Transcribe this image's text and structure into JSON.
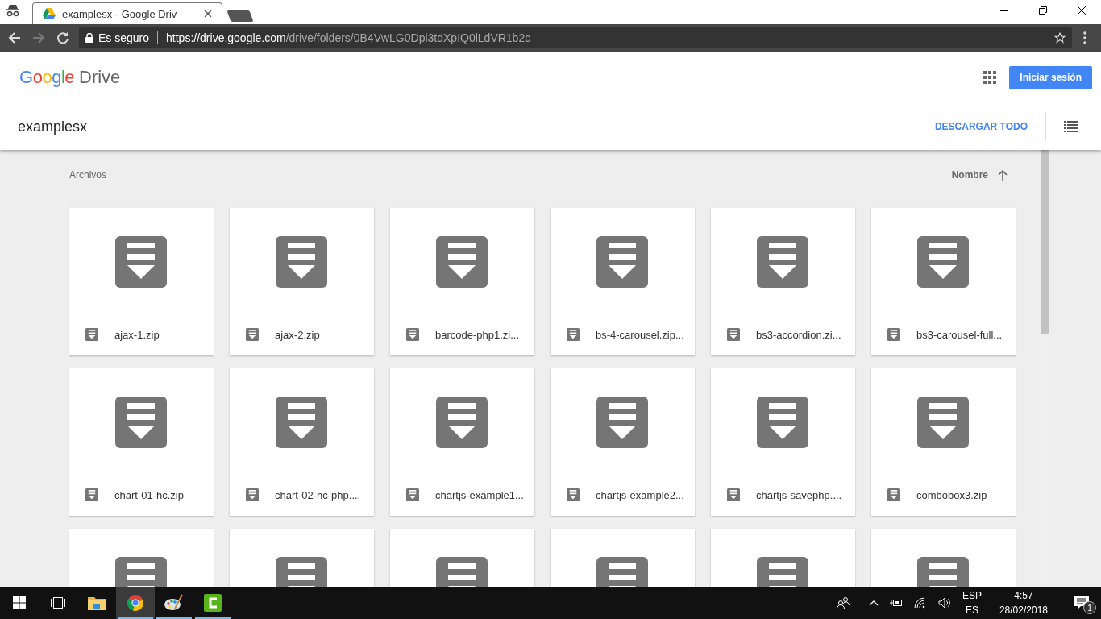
{
  "browser": {
    "tabs": [
      {
        "title": "examplesx - Google Driv",
        "selected": true
      }
    ],
    "address": {
      "security": "Es seguro",
      "url_origin": "https://drive.google.com",
      "url_path": "/drive/folders/0B4VwLG0Dpi3tdXpIQ0lLdVR1b2c"
    }
  },
  "header": {
    "logo_google": "Google",
    "logo_product": "Drive",
    "sign_in": "Iniciar sesión"
  },
  "folder": {
    "title": "examplesx",
    "download_all": "DESCARGAR TODO"
  },
  "files": {
    "section": "Archivos",
    "sort": "Nombre",
    "items": [
      {
        "kind": "zip",
        "name": "ajax-1.zip"
      },
      {
        "kind": "zip",
        "name": "ajax-2.zip"
      },
      {
        "kind": "zip",
        "name": "barcode-php1.zi..."
      },
      {
        "kind": "zip",
        "name": "bs-4-carousel.zip..."
      },
      {
        "kind": "zip",
        "name": "bs3-accordion.zi..."
      },
      {
        "kind": "zip",
        "name": "bs3-carousel-full..."
      },
      {
        "kind": "zip",
        "name": "chart-01-hc.zip"
      },
      {
        "kind": "zip",
        "name": "chart-02-hc-php...."
      },
      {
        "kind": "zip",
        "name": "chartjs-example1..."
      },
      {
        "kind": "zip",
        "name": "chartjs-example2..."
      },
      {
        "kind": "zip",
        "name": "chartjs-savephp...."
      },
      {
        "kind": "zip",
        "name": "combobox3.zip"
      },
      {
        "kind": "zip"
      },
      {
        "kind": "zip"
      },
      {
        "kind": "zip"
      },
      {
        "kind": "zip"
      },
      {
        "kind": "zip"
      },
      {
        "kind": "zip"
      }
    ]
  },
  "taskbar": {
    "apps": [
      {
        "kind": "explorer",
        "running": false,
        "selected": false
      },
      {
        "kind": "chrome",
        "running": true,
        "selected": true
      },
      {
        "kind": "paint",
        "running": true,
        "selected": false
      },
      {
        "kind": "camtasia",
        "running": true,
        "selected": false
      }
    ],
    "language": "ESP",
    "layout": "ES",
    "time": "4:57",
    "date": "28/02/2018",
    "notifications": "1"
  }
}
